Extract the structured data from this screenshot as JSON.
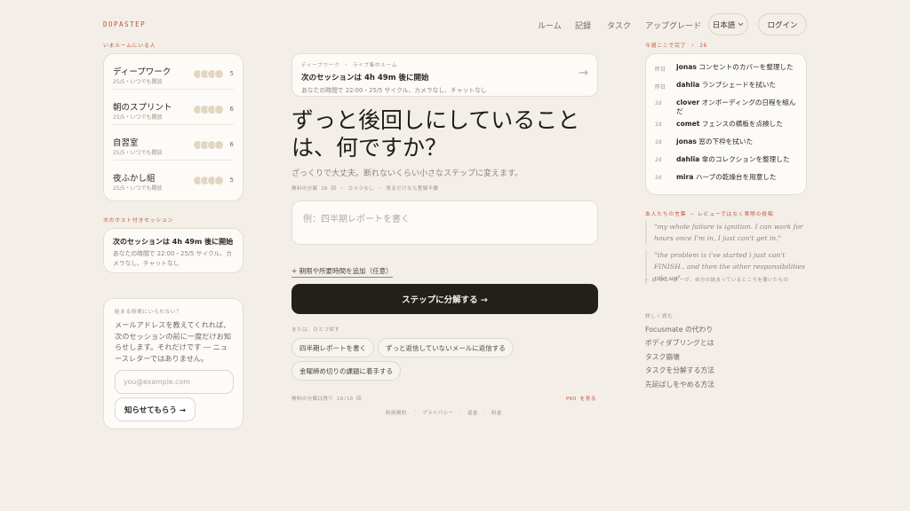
{
  "header": {
    "logo": "DOPASTEP",
    "nav": [
      "ルーム",
      "記録",
      "タスク",
      "アップグレード"
    ],
    "language": "日本語",
    "login": "ログイン"
  },
  "rooms_section": {
    "label": "いまルームにいる人",
    "rooms": [
      {
        "name": "ディープワーク",
        "sub": "25/5・いつでも開放",
        "count": "5"
      },
      {
        "name": "朝のスプリント",
        "sub": "25/5・いつでも開放",
        "count": "6"
      },
      {
        "name": "自習室",
        "sub": "25/5・いつでも開放",
        "count": "6"
      },
      {
        "name": "夜ふかし組",
        "sub": "25/5・いつでも開放",
        "count": "5"
      }
    ]
  },
  "host_section": {
    "label": "次のホスト付きセッション",
    "title": "次のセッションは 4h 49m 後に開始",
    "sub": "あなたの時間で 22:00・25/5 サイクル、カメラなし、チャットなし"
  },
  "notify": {
    "label": "始まる時間にいられない？",
    "text": "メールアドレスを教えてくれれば、次のセッションの前に一度だけお知らせします。それだけです ― ニュースレターではありません。",
    "email_placeholder": "you@example.com",
    "button": "知らせてもらう →"
  },
  "banner": {
    "eyebrow": "ディープワーク ・ ライブ集中ルーム",
    "title": "次のセッションは 4h 49m 後に開始",
    "sub": "あなたの時間で 22:00・25/5 サイクル、カメラなし、チャットなし",
    "arrow": "→"
  },
  "main": {
    "headline": "ずっと後回しにしていることは、何ですか？",
    "subtitle": "ざっくりで大丈夫。断れないくらい小さなステップに変えます。",
    "meta": "無料の分解 10 回 ・ カメラなし ・ 見るだけなら登録不要",
    "input_placeholder": "例：四半期レポートを書く",
    "add_link": "+ 期限や所要時間を追加（任意）",
    "cta": "ステップに分解する →",
    "or_label": "または、ひとつ試す",
    "chips": [
      "四半期レポートを書く",
      "ずっと返信していないメールに返信する",
      "金曜締め切りの課題に着手する"
    ],
    "quota": "無料の分解は残り 10/10 回",
    "pro": "PRO を見る",
    "footer": [
      "利用規約",
      "プライバシー",
      "返金",
      "料金"
    ]
  },
  "done_section": {
    "label": "今週ここで完了 ・ 26",
    "items": [
      {
        "when": "昨日",
        "user": "jonas",
        "text": "コンセントのカバーを整理した"
      },
      {
        "when": "昨日",
        "user": "dahlia",
        "text": "ランプシェードを拭いた"
      },
      {
        "when": "2d",
        "user": "clover",
        "text": "オンボーディングの日程を組んだ"
      },
      {
        "when": "2d",
        "user": "comet",
        "text": "フェンスの横板を点検した"
      },
      {
        "when": "2d",
        "user": "jonas",
        "text": "窓の下枠を拭いた"
      },
      {
        "when": "2d",
        "user": "dahlia",
        "text": "傘のコレクションを整理した"
      },
      {
        "when": "2d",
        "user": "mira",
        "text": "ハーブの乾燥台を用意した"
      }
    ]
  },
  "quotes_section": {
    "label": "本人たちの言葉 ― レビューではなく実際の投稿",
    "quotes": [
      "\"my whole failure is ignition. I can work for hours once I'm in, I just can't get in.\"",
      "\"the problem is i've started i just can't FINISH.. and then the other responsibilities pile up\""
    ],
    "attribution": "― X のユーザーが、自分の詰まっているところを書いたもの"
  },
  "read_more": {
    "label": "詳しく読む",
    "links": [
      "Focusmate の代わり",
      "ボディダブリングとは",
      "タスク崩壊",
      "タスクを分解する方法",
      "先延ばしをやめる方法"
    ]
  }
}
